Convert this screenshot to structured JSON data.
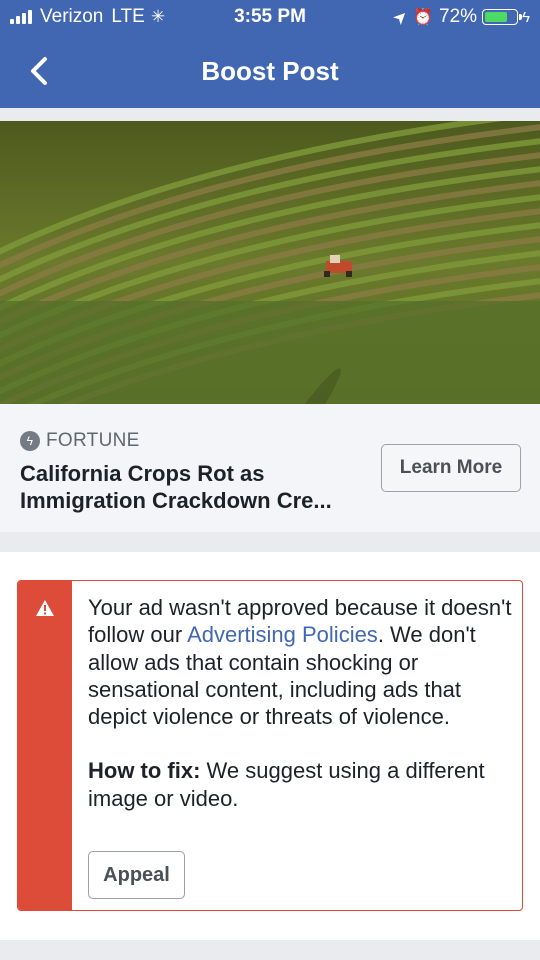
{
  "status_bar": {
    "carrier": "Verizon",
    "network": "LTE",
    "time": "3:55 PM",
    "battery_percent": "72%",
    "battery_level": 0.72,
    "icons": [
      "signal-bars-icon",
      "activity-spinner-icon",
      "location-arrow-icon",
      "alarm-icon",
      "battery-icon",
      "charging-bolt-icon"
    ],
    "battery_color": "#4cd964"
  },
  "nav": {
    "title": "Boost Post",
    "back_icon": "chevron-left-icon",
    "color": "#4267b2"
  },
  "post": {
    "image_icon": "field-photo",
    "source": "FORTUNE",
    "source_icon": "bolt-circle-icon",
    "headline": "California Crops Rot as Immigration Crackdown Cre...",
    "cta_label": "Learn More"
  },
  "alert": {
    "icon": "warning-triangle-icon",
    "accent_color": "#dd4b39",
    "message_before_link": "Your ad wasn't approved because it doesn't follow our ",
    "link_text": "Advertising Policies",
    "message_after_link": ". We don't allow ads that contain shocking or sensational content, including ads that depict violence or threats of violence.",
    "fix_label": "How to fix:",
    "fix_text": " We suggest using a different image or video.",
    "appeal_label": "Appeal"
  }
}
